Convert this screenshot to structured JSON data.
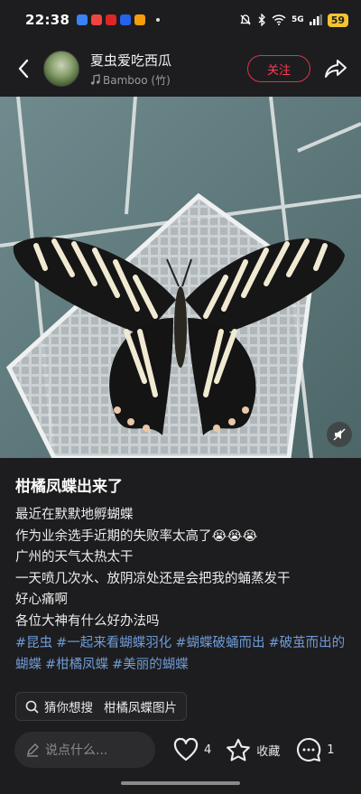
{
  "status_bar": {
    "time": "22:38",
    "network": "5G",
    "battery": "59",
    "app_icon_colors": [
      "#3b82f6",
      "#ef4444",
      "#dc2626",
      "#2563eb",
      "#f59e0b"
    ]
  },
  "header": {
    "user_name": "夏虫爱吃西瓜",
    "music": "Bamboo (竹)",
    "follow_label": "关注",
    "colors": {
      "follow": "#ff3b55"
    }
  },
  "post": {
    "title": "柑橘凤蝶出来了",
    "lines": [
      "最近在默默地孵蝴蝶",
      "作为业余选手近期的失败率太高了😭😭😭",
      "广州的天气太热太干",
      "一天喷几次水、放阴凉处还是会把我的蛹蒸发干",
      "好心痛啊",
      "各位大神有什么好办法吗"
    ],
    "tags": [
      "#昆虫",
      "#一起来看蝴蝶羽化",
      "#蝴蝶破蛹而出",
      "#破茧而出的蝴蝶",
      "#柑橘凤蝶",
      "#美丽的蝴蝶"
    ],
    "tag_color": "#6f9bd6"
  },
  "search_chip": {
    "label": "猜你想搜",
    "query": "柑橘凤蝶图片"
  },
  "bottom_bar": {
    "comment_placeholder": "说点什么...",
    "like_count": "4",
    "favorite_label": "收藏",
    "comment_count": "1"
  }
}
